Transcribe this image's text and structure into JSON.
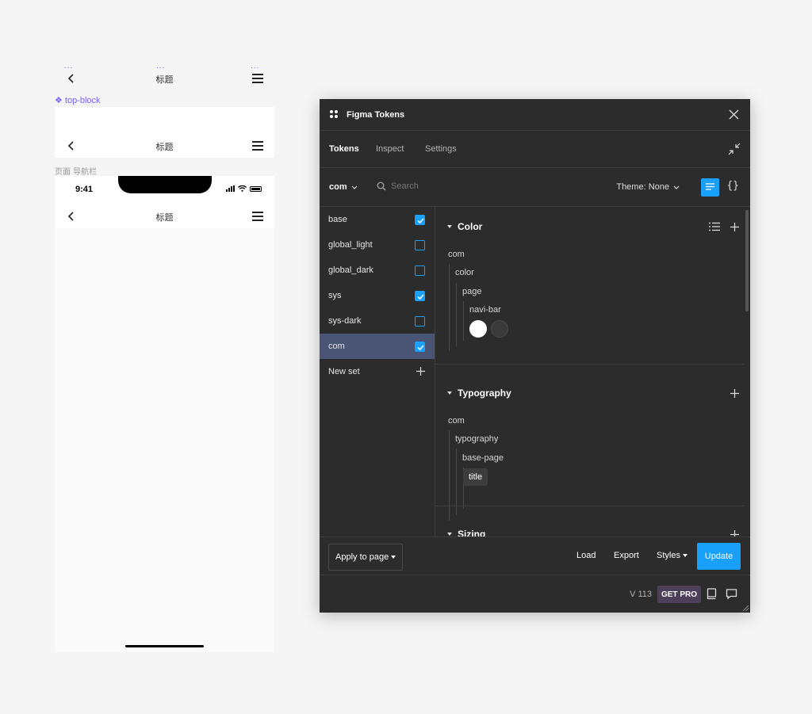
{
  "canvas": {
    "nav_title": "标题",
    "dots": "...",
    "component_label": "❖ top-block",
    "frame_label": "页面 导航栏",
    "status_time": "9:41"
  },
  "plugin": {
    "title": "Figma Tokens",
    "tabs": [
      {
        "label": "Tokens",
        "active": true
      },
      {
        "label": "Inspect",
        "active": false
      },
      {
        "label": "Settings",
        "active": false
      }
    ],
    "toolbar": {
      "set_selector": "com",
      "search_placeholder": "Search",
      "theme_label": "Theme: None"
    },
    "sets": [
      {
        "label": "base",
        "checked": true
      },
      {
        "label": "global_light",
        "checked": false
      },
      {
        "label": "global_dark",
        "checked": false
      },
      {
        "label": "sys",
        "checked": true
      },
      {
        "label": "sys-dark",
        "checked": false
      },
      {
        "label": "com",
        "checked": true,
        "active": true
      }
    ],
    "new_set_label": "New set",
    "sections": {
      "color": {
        "title": "Color",
        "tree": [
          "com",
          "color",
          "page",
          "navi-bar"
        ],
        "swatches": [
          "#ffffff",
          "#3a3a3a"
        ]
      },
      "typography": {
        "title": "Typography",
        "tree": [
          "com",
          "typography",
          "base-page"
        ],
        "token": "title"
      },
      "sizing": {
        "title": "Sizing"
      }
    },
    "footer": {
      "apply_label": "Apply to page",
      "load_label": "Load",
      "export_label": "Export",
      "styles_label": "Styles",
      "update_label": "Update",
      "version": "V 113",
      "get_pro": "GET PRO"
    }
  },
  "colors": {
    "accent": "#18a0fb",
    "panel_bg": "#2c2c2c",
    "active_set_bg": "#4a5575",
    "component_purple": "#7b61ff"
  }
}
